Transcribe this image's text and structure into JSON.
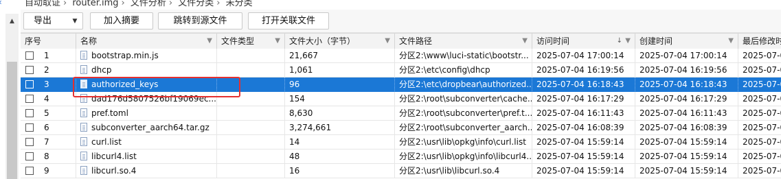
{
  "breadcrumb": [
    "自动取证",
    "router.img",
    "文件分析",
    "文件分类",
    "未分类"
  ],
  "toolbar": {
    "export_label": "导出",
    "add_summary_label": "加入摘要",
    "jump_source_label": "跳转到源文件",
    "open_related_label": "打开关联文件"
  },
  "columns": [
    "序号",
    "名称",
    "文件类型",
    "文件大小（字节）",
    "文件路径",
    "访问时间",
    "创建时间",
    "最后修改时"
  ],
  "rows": [
    {
      "num": "1",
      "name": "bootstrap.min.js",
      "type": "",
      "size": "21,667",
      "path": "分区2:\\www\\luci-static\\bootstr...",
      "atime": "2025-07-04 17:00:14",
      "ctime": "2025-07-04 17:00:14",
      "mtime": "2025-07-0"
    },
    {
      "num": "2",
      "name": "dhcp",
      "type": "",
      "size": "1,061",
      "path": "分区2:\\etc\\config\\dhcp",
      "atime": "2025-07-04 16:19:56",
      "ctime": "2025-07-04 16:19:56",
      "mtime": "2025-07-0"
    },
    {
      "num": "3",
      "name": "authorized_keys",
      "type": "",
      "size": "96",
      "path": "分区2:\\etc\\dropbear\\authorized...",
      "atime": "2025-07-04 16:18:43",
      "ctime": "2025-07-04 16:18:43",
      "mtime": "2025-07-0"
    },
    {
      "num": "4",
      "name": "dad176d5807526bf19069ec...",
      "type": "",
      "size": "154",
      "path": "分区2:\\root\\subconverter\\cache...",
      "atime": "2025-07-04 16:17:29",
      "ctime": "2025-07-04 16:17:29",
      "mtime": "2025-07-0"
    },
    {
      "num": "5",
      "name": "pref.toml",
      "type": "",
      "size": "8,630",
      "path": "分区2:\\root\\subconverter\\pref.t...",
      "atime": "2025-07-04 16:11:43",
      "ctime": "2025-07-04 16:11:43",
      "mtime": "2025-07-0"
    },
    {
      "num": "6",
      "name": "subconverter_aarch64.tar.gz",
      "type": "",
      "size": "3,274,661",
      "path": "分区2:\\root\\subconverter_aarch...",
      "atime": "2025-07-04 16:08:39",
      "ctime": "2025-07-04 16:08:39",
      "mtime": "2025-07-0"
    },
    {
      "num": "7",
      "name": "curl.list",
      "type": "",
      "size": "14",
      "path": "分区2:\\usr\\lib\\opkg\\info\\curl.list",
      "atime": "2025-07-04 15:59:14",
      "ctime": "2025-07-04 15:59:14",
      "mtime": "2025-07-0"
    },
    {
      "num": "8",
      "name": "libcurl4.list",
      "type": "",
      "size": "48",
      "path": "分区2:\\usr\\lib\\opkg\\info\\libcurl4...",
      "atime": "2025-07-04 15:59:14",
      "ctime": "2025-07-04 15:59:14",
      "mtime": "2025-07-0"
    },
    {
      "num": "9",
      "name": "libcurl.so.4",
      "type": "",
      "size": "16",
      "path": "分区2:\\usr\\lib\\libcurl.so.4",
      "atime": "2025-07-04 15:59:14",
      "ctime": "2025-07-04 15:59:14",
      "mtime": "2025-07-0"
    }
  ],
  "selected_row": 2,
  "colors": {
    "selection": "#1b78d6",
    "annotation_box": "#e53030"
  }
}
